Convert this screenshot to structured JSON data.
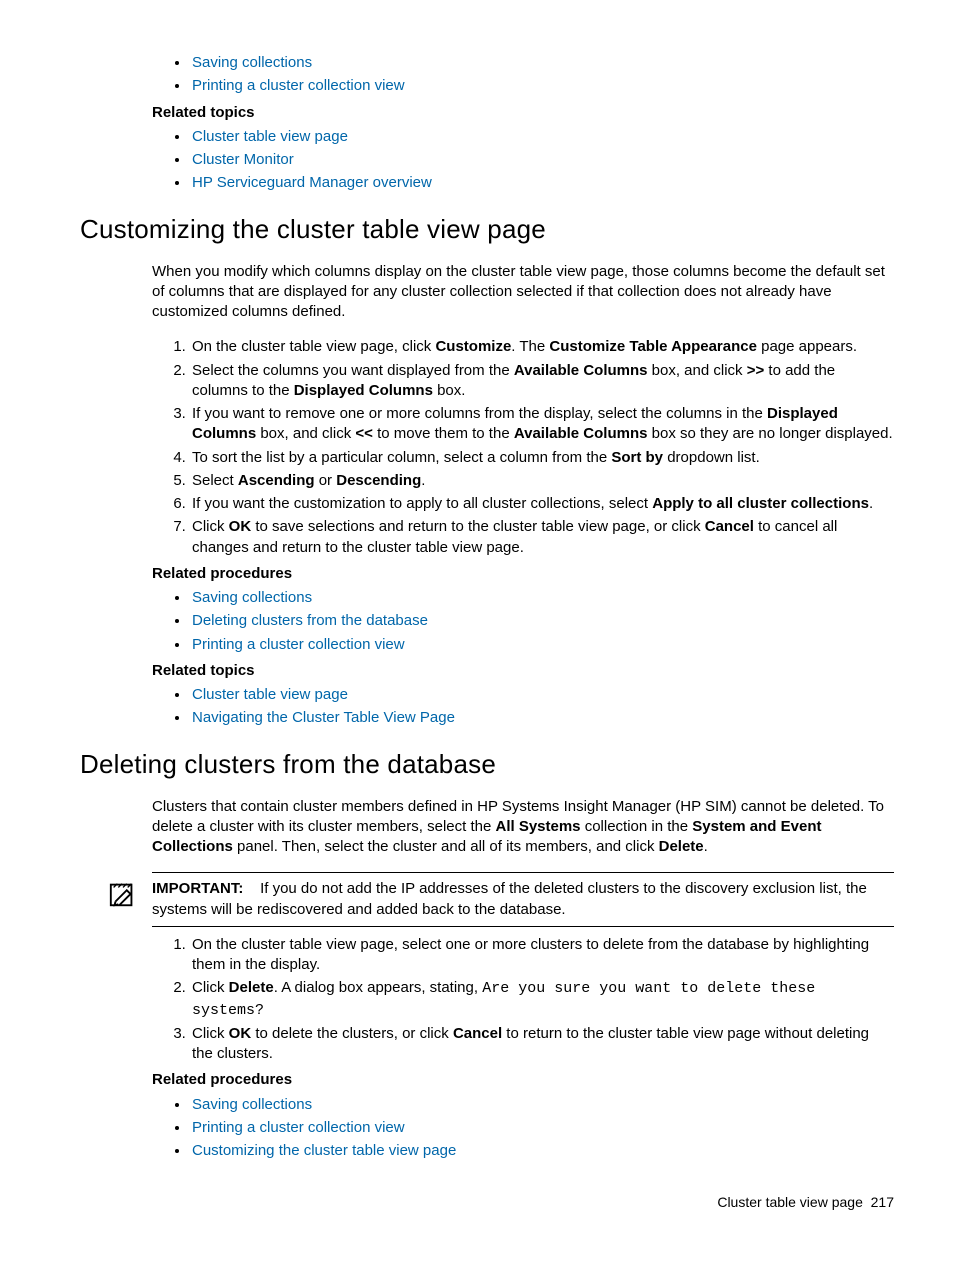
{
  "top": {
    "links1": [
      "Saving collections",
      "Printing a cluster collection view"
    ],
    "related_topics_label": "Related topics",
    "links2": [
      "Cluster table view page",
      "Cluster Monitor",
      "HP Serviceguard Manager overview"
    ]
  },
  "sec1": {
    "heading": "Customizing the cluster table view page",
    "intro": "When you modify which columns display on the cluster table view page, those columns become the default set of columns that are displayed for any cluster collection selected if that collection does not already have customized columns defined.",
    "step1_a": "On the cluster table view page, click ",
    "step1_b": "Customize",
    "step1_c": ". The ",
    "step1_d": "Customize Table Appearance",
    "step1_e": " page appears.",
    "step2_a": "Select the columns you want displayed from the ",
    "step2_b": "Available Columns",
    "step2_c": " box, and click ",
    "step2_d": ">>",
    "step2_e": " to add the columns to the ",
    "step2_f": "Displayed Columns",
    "step2_g": " box.",
    "step3_a": "If you want to remove one or more columns from the display, select the columns in the ",
    "step3_b": "Displayed Columns",
    "step3_c": " box, and click ",
    "step3_d": "<<",
    "step3_e": " to move them to the ",
    "step3_f": "Available Columns",
    "step3_g": " box so they are no longer displayed.",
    "step4_a": "To sort the list by a particular column, select a column from the ",
    "step4_b": "Sort by",
    "step4_c": " dropdown list.",
    "step5_a": "Select ",
    "step5_b": "Ascending",
    "step5_c": " or ",
    "step5_d": "Descending",
    "step5_e": ".",
    "step6_a": "If you want the customization to apply to all cluster collections, select ",
    "step6_b": "Apply to all cluster collections",
    "step6_c": ".",
    "step7_a": "Click ",
    "step7_b": "OK",
    "step7_c": " to save selections and return to the cluster table view page, or click ",
    "step7_d": "Cancel",
    "step7_e": " to cancel all changes and return to the cluster table view page.",
    "related_procedures_label": "Related procedures",
    "proc_links": [
      "Saving collections",
      "Deleting clusters from the database",
      "Printing a cluster collection view"
    ],
    "related_topics_label": "Related topics",
    "topic_links": [
      "Cluster table view page",
      "Navigating the Cluster Table View Page"
    ]
  },
  "sec2": {
    "heading": "Deleting clusters from the database",
    "intro_a": "Clusters that contain cluster members defined in HP Systems Insight Manager (HP SIM) cannot be deleted. To delete a cluster with its cluster members, select the ",
    "intro_b": "All Systems",
    "intro_c": " collection in the ",
    "intro_d": "System and Event Collections",
    "intro_e": " panel. Then, select the cluster and all of its members, and click ",
    "intro_f": "Delete",
    "intro_g": ".",
    "note_label": "IMPORTANT:",
    "note_text": "If you do not add the IP addresses of the deleted clusters to the discovery exclusion list, the systems will be rediscovered and added back to the database.",
    "step1": "On the cluster table view page, select one or more clusters to delete from the database by highlighting them in the display.",
    "step2_a": "Click ",
    "step2_b": "Delete",
    "step2_c": ". A dialog box appears, stating, ",
    "step2_d": "Are you sure you want to delete these systems?",
    "step3_a": "Click ",
    "step3_b": "OK",
    "step3_c": " to delete the clusters, or click ",
    "step3_d": "Cancel",
    "step3_e": " to return to the cluster table view page without deleting the clusters.",
    "related_procedures_label": "Related procedures",
    "proc_links": [
      "Saving collections",
      "Printing a cluster collection view",
      "Customizing the cluster table view page"
    ]
  },
  "footer": {
    "text": "Cluster table view page",
    "page": "217"
  }
}
